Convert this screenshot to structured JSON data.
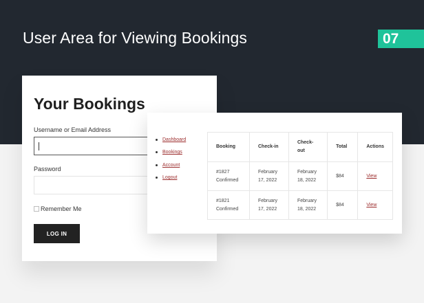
{
  "banner": {
    "title": "User Area for Viewing Bookings",
    "badge": "07",
    "badge_color": "#1fc39a",
    "background_color": "#222830"
  },
  "login": {
    "heading": "Your Bookings",
    "username_label": "Username or Email Address",
    "username_value": "",
    "password_label": "Password",
    "password_value": "",
    "remember_label": "Remember Me",
    "remember_checked": false,
    "submit_label": "LOG IN"
  },
  "account": {
    "nav": [
      {
        "label": "Dashboard"
      },
      {
        "label": "Bookings"
      },
      {
        "label": "Account"
      },
      {
        "label": "Logout"
      }
    ],
    "table": {
      "headers": [
        "Booking",
        "Check-in",
        "Check-out",
        "Total",
        "Actions"
      ],
      "rows": [
        {
          "booking": "#1827 Confirmed",
          "check_in": "February 17, 2022",
          "check_out": "February 18, 2022",
          "total": "$84",
          "action": "View"
        },
        {
          "booking": "#1821 Confirmed",
          "check_in": "February 17, 2022",
          "check_out": "February 18, 2022",
          "total": "$84",
          "action": "View"
        }
      ]
    },
    "link_color": "#9b2b2b"
  }
}
